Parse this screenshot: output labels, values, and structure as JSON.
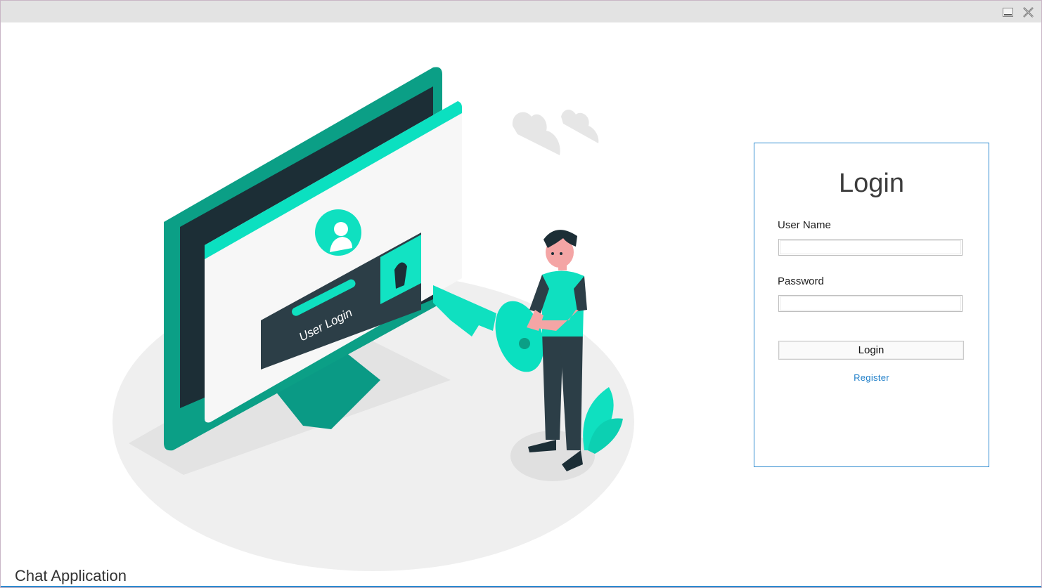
{
  "window": {
    "controls": {
      "minimize_icon": "minimize-icon",
      "close_icon": "close-icon"
    }
  },
  "illustration": {
    "label": "User Login",
    "accent_color": "#03e6c4",
    "dark_color": "#2c3e47"
  },
  "login": {
    "title": "Login",
    "username_label": "User Name",
    "username_value": "",
    "password_label": "Password",
    "password_value": "",
    "button_label": "Login",
    "register_label": "Register",
    "border_color": "#2e8bd0"
  },
  "footer": {
    "app_name": "Chat Application"
  }
}
